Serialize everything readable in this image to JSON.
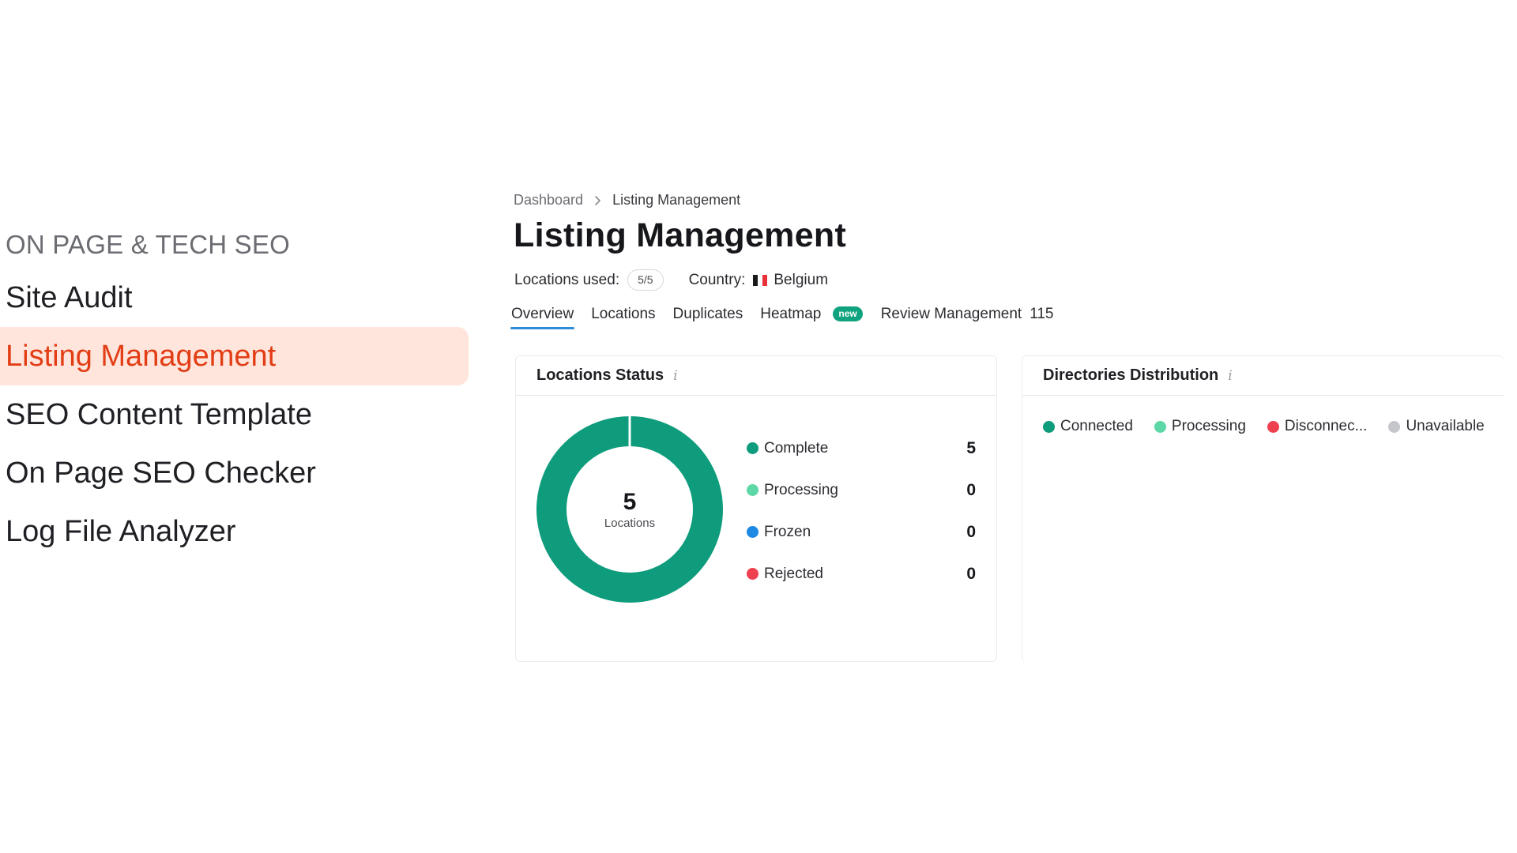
{
  "sidebar": {
    "section_label": "ON PAGE & TECH SEO",
    "items": [
      {
        "label": "Site Audit",
        "active": false
      },
      {
        "label": "Listing Management",
        "active": true
      },
      {
        "label": "SEO Content Template",
        "active": false
      },
      {
        "label": "On Page SEO Checker",
        "active": false
      },
      {
        "label": "Log File Analyzer",
        "active": false
      }
    ]
  },
  "breadcrumb": {
    "items": [
      "Dashboard",
      "Listing Management"
    ]
  },
  "header": {
    "title": "Listing Management",
    "locations_used_label": "Locations used:",
    "locations_used_value": "5/5",
    "country_label": "Country:",
    "country_value": "Belgium"
  },
  "tabs": [
    {
      "label": "Overview",
      "active": true
    },
    {
      "label": "Locations"
    },
    {
      "label": "Duplicates"
    },
    {
      "label": "Heatmap",
      "badge": "new"
    },
    {
      "label": "Review Management",
      "count": "115"
    }
  ],
  "locations_status": {
    "title": "Locations Status",
    "info_icon": "i",
    "total": "5",
    "total_label": "Locations",
    "rows": [
      {
        "label": "Complete",
        "value": "5",
        "color": "#0e9c7c"
      },
      {
        "label": "Processing",
        "value": "0",
        "color": "#5ed7a6"
      },
      {
        "label": "Frozen",
        "value": "0",
        "color": "#1e88e5"
      },
      {
        "label": "Rejected",
        "value": "0",
        "color": "#ef4050"
      }
    ]
  },
  "directories": {
    "title": "Directories Distribution",
    "info_icon": "i",
    "legend": [
      {
        "label": "Connected",
        "color": "#0e9c7c"
      },
      {
        "label": "Processing",
        "color": "#5ed7a6"
      },
      {
        "label": "Disconnec...",
        "color": "#ef4050"
      },
      {
        "label": "Unavailable",
        "color": "#c4c6cc"
      }
    ]
  },
  "colors": {
    "accent": "#e23d14",
    "active_bg": "#ffe5dc",
    "tab_underline": "#2e8bd8",
    "donut": "#0e9c7c"
  }
}
